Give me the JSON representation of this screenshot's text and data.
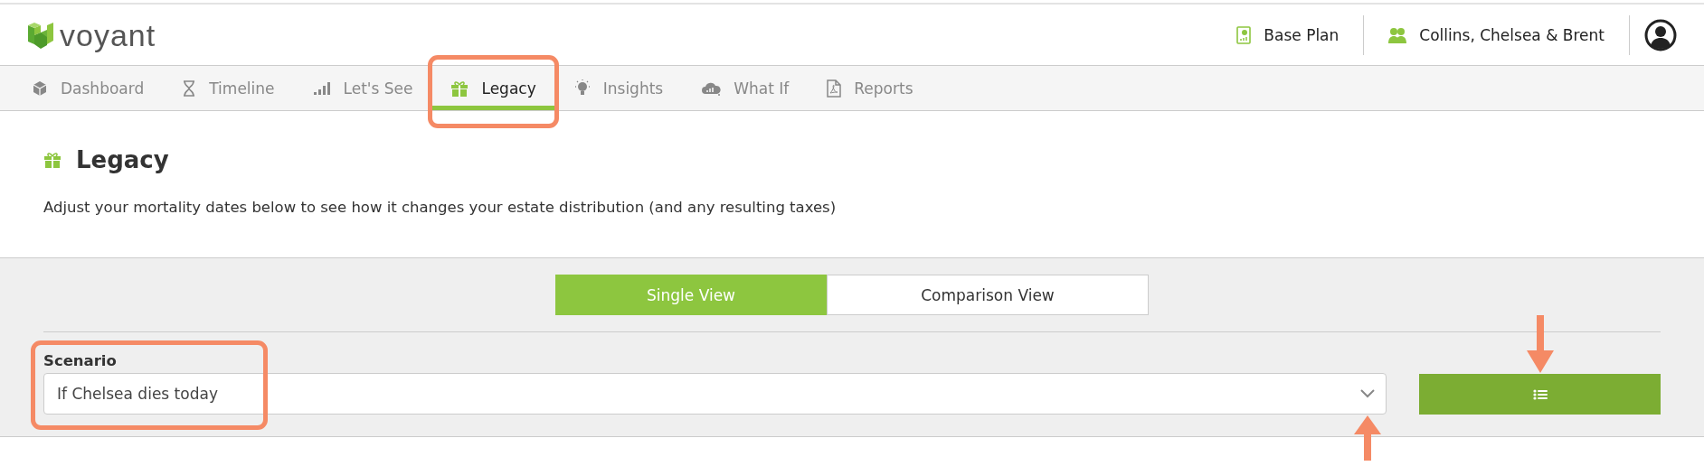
{
  "header": {
    "logo": "voyant",
    "plan": "Base Plan",
    "client": "Collins, Chelsea & Brent"
  },
  "tabs": [
    {
      "label": "Dashboard",
      "selected": false,
      "callout": false
    },
    {
      "label": "Timeline",
      "selected": false,
      "callout": false
    },
    {
      "label": "Let's See",
      "selected": false,
      "callout": false
    },
    {
      "label": "Legacy",
      "selected": true,
      "callout": true
    },
    {
      "label": "Insights",
      "selected": false,
      "callout": false
    },
    {
      "label": "What If",
      "selected": false,
      "callout": false
    },
    {
      "label": "Reports",
      "selected": false,
      "callout": false
    }
  ],
  "page": {
    "title": "Legacy",
    "description": "Adjust your mortality dates below to see how it changes your estate distribution (and any resulting taxes)"
  },
  "view_toggle": [
    {
      "label": "Single View",
      "selected": true
    },
    {
      "label": "Comparison View",
      "selected": false
    }
  ],
  "scenario": {
    "label": "Scenario",
    "value": "If Chelsea dies today",
    "callout": true,
    "arrow_below": true
  },
  "list_button": {
    "arrow_above": true
  }
}
